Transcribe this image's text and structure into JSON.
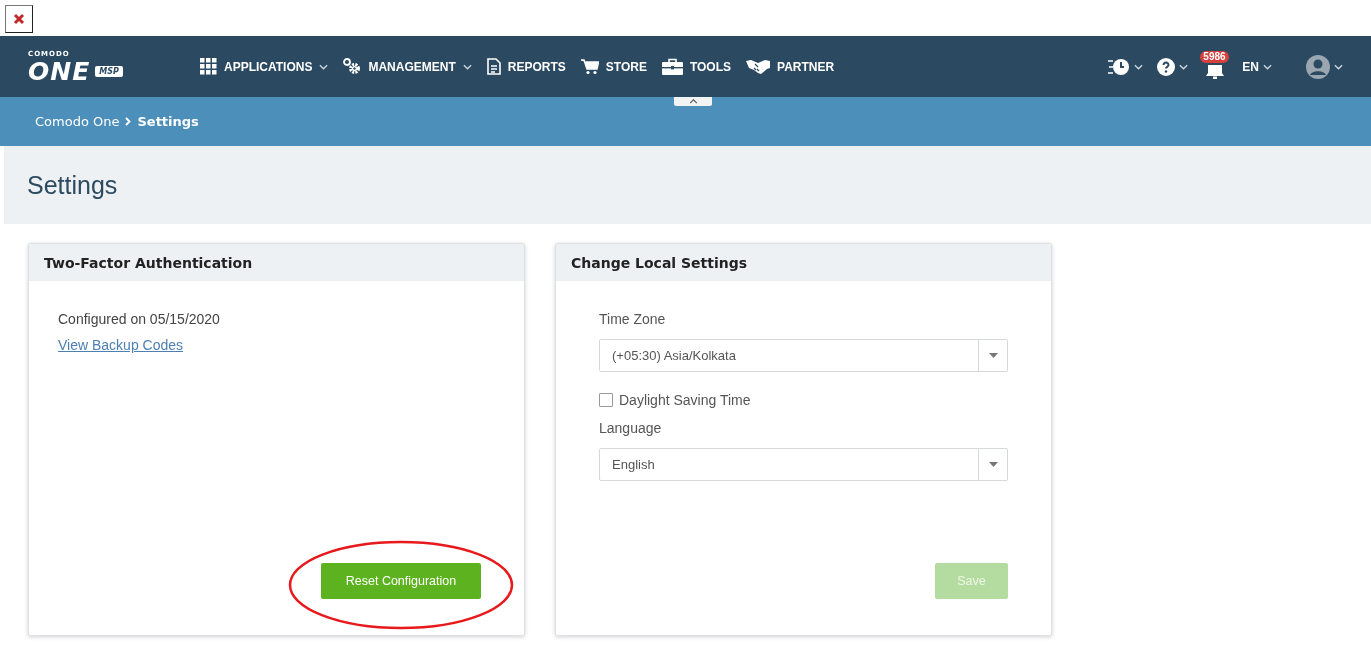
{
  "header": {
    "logo": {
      "small": "COMODO",
      "main": "ONE",
      "badge": "MSP"
    },
    "nav": [
      {
        "label": "APPLICATIONS",
        "dropdown": true
      },
      {
        "label": "MANAGEMENT",
        "dropdown": true
      },
      {
        "label": "REPORTS",
        "dropdown": false
      },
      {
        "label": "STORE",
        "dropdown": false
      },
      {
        "label": "TOOLS",
        "dropdown": false
      },
      {
        "label": "PARTNER",
        "dropdown": false
      }
    ],
    "notification_count": "5986",
    "language": "EN"
  },
  "breadcrumb": [
    {
      "label": "Comodo One",
      "current": false
    },
    {
      "label": "Settings",
      "current": true
    }
  ],
  "page_title": "Settings",
  "two_factor": {
    "title": "Two-Factor Authentication",
    "status": "Configured on 05/15/2020",
    "link": "View Backup Codes",
    "button": "Reset Configuration",
    "highlighted": true
  },
  "local_settings": {
    "title": "Change Local Settings",
    "timezone_label": "Time Zone",
    "timezone": "(+05:30) Asia/Kolkata",
    "dst": {
      "label": "Daylight Saving Time",
      "checked": false
    },
    "language_label": "Language",
    "language": "English",
    "save": {
      "label": "Save",
      "disabled": true
    }
  }
}
